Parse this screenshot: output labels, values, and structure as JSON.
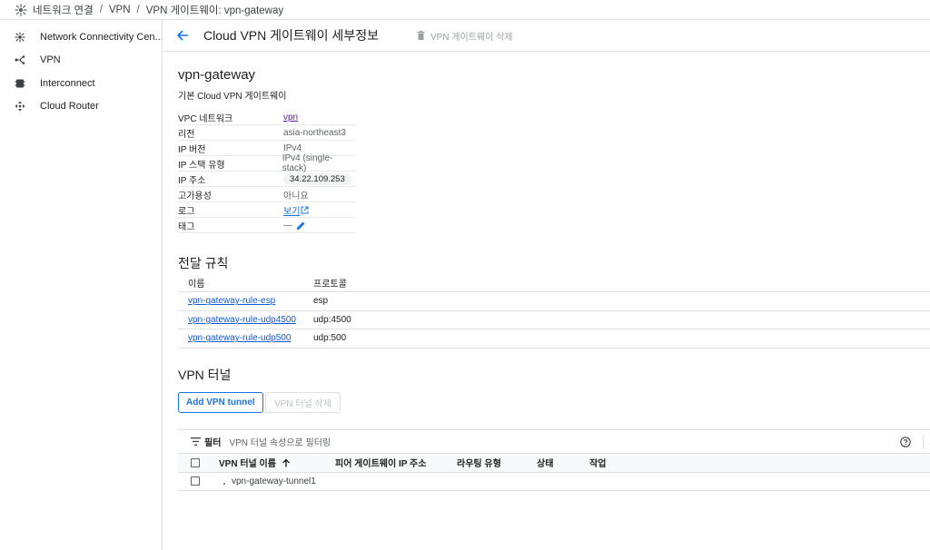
{
  "breadcrumb": {
    "items": [
      "네트워크 연결",
      "VPN",
      "VPN 게이트웨이: vpn-gateway"
    ],
    "separator": "/"
  },
  "sidebar": {
    "items": [
      {
        "label": "Network Connectivity Cen...",
        "icon": "network-hub-icon"
      },
      {
        "label": "VPN",
        "icon": "vpn-icon"
      },
      {
        "label": "Interconnect",
        "icon": "interconnect-icon"
      },
      {
        "label": "Cloud Router",
        "icon": "router-icon"
      }
    ]
  },
  "header": {
    "title": "Cloud VPN 게이트웨이 세부정보",
    "delete_label": "VPN 게이트웨이 삭제"
  },
  "gateway": {
    "name": "vpn-gateway",
    "subtitle": "기본 Cloud VPN 게이트웨이",
    "details": [
      {
        "key": "VPC 네트워크",
        "value": "vpn"
      },
      {
        "key": "리전",
        "value": "asia-northeast3"
      },
      {
        "key": "IP 버전",
        "value": "IPv4"
      },
      {
        "key": "IP 스택 유형",
        "value": "IPv4 (single-stack)"
      },
      {
        "key": "IP 주소",
        "value": "34.22.109.253"
      },
      {
        "key": "고가용성",
        "value": "아니요"
      },
      {
        "key": "로그",
        "value": "보기"
      },
      {
        "key": "태그",
        "value": "—"
      }
    ]
  },
  "forwarding": {
    "title": "전달 규칙",
    "headers": [
      "이름",
      "프로토콜"
    ],
    "rows": [
      {
        "name": "vpn-gateway-rule-esp",
        "protocol": "esp"
      },
      {
        "name": "vpn-gateway-rule-udp4500",
        "protocol": "udp:4500"
      },
      {
        "name": "vpn-gateway-rule-udp500",
        "protocol": "udp:500"
      }
    ]
  },
  "tunnels": {
    "title": "VPN 터널",
    "add_label": "Add VPN tunnel",
    "delete_label": "VPN 터널 삭제",
    "filter_label": "필터",
    "filter_placeholder": "VPN 터널 속성으로 필터링",
    "headers": [
      "VPN 터널 이름",
      "피어 게이트웨이 IP 주소",
      "라우팅 유형",
      "상태",
      "작업"
    ],
    "rows": [
      {
        "name": "vpn-gateway-tunnel1",
        "peer_ip": "",
        "routing": "",
        "status": "",
        "action": ""
      }
    ]
  },
  "colors": {
    "accent": "#1a73e8",
    "visited_link": "#681da8",
    "border": "#e0e0e0"
  }
}
